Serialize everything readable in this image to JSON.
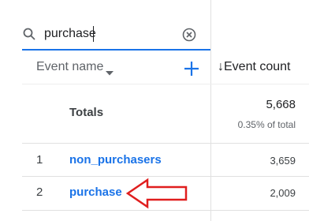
{
  "search": {
    "value": "purchase",
    "placeholder": ""
  },
  "table": {
    "dimension_header": "Event name",
    "metric_header": "↓Event count",
    "totals": {
      "label": "Totals",
      "value": "5,668",
      "percent": "0.35% of total"
    },
    "rows": [
      {
        "index": "1",
        "name": "non_purchasers",
        "value": "3,659"
      },
      {
        "index": "2",
        "name": "purchase",
        "value": "2,009"
      }
    ]
  },
  "colors": {
    "accent": "#1a73e8",
    "annotation_arrow": "#e01e1e"
  },
  "icons": [
    "search-icon",
    "clear-icon",
    "dropdown-icon",
    "add-icon",
    "arrow-icon"
  ]
}
